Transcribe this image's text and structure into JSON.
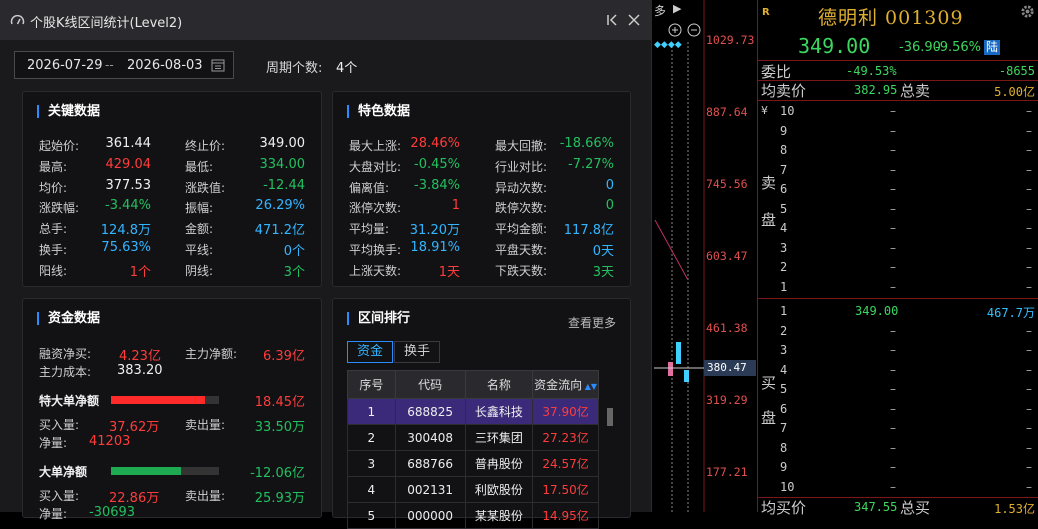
{
  "chart": {
    "price_axis": [
      "1029.73",
      "887.64",
      "745.56",
      "603.47",
      "461.38",
      "380.47",
      "319.29",
      "177.21"
    ],
    "top_text": "多"
  },
  "quote": {
    "r_badge": "R",
    "name": "德明利 001309",
    "price": "349.00",
    "change": "-36.90",
    "change_pct": "-9.56%",
    "tag": "陆",
    "weibi_label": "委比",
    "weibi_pct": "-49.53%",
    "weibi_diff": "-8655",
    "avg_sell_label": "均卖价",
    "avg_sell_price": "382.95",
    "total_sell_label": "总卖",
    "total_sell": "5.00亿",
    "sell_side": [
      "卖",
      "盘"
    ],
    "yen": "¥",
    "sell_levels": [
      "10",
      "9",
      "8",
      "7",
      "6",
      "5",
      "4",
      "3",
      "2",
      "1"
    ],
    "buy_side": [
      "买",
      "盘"
    ],
    "buy_levels": [
      "1",
      "2",
      "3",
      "4",
      "5",
      "6",
      "7",
      "8",
      "9",
      "10"
    ],
    "buy1_price": "349.00",
    "buy1_vol": "467.7万",
    "dash": "–",
    "avg_buy_label": "均买价",
    "avg_buy_price": "347.55",
    "total_buy_label": "总买",
    "total_buy": "1.53亿"
  },
  "dialog": {
    "title": "个股K线区间统计(Level2)",
    "start_date": "2026-07-29",
    "date_sep": "--",
    "end_date": "2026-08-03",
    "period_label": "周期个数:",
    "period_value": "4个",
    "key": {
      "title": "关键数据",
      "rows": [
        [
          "起始价:",
          "361.44",
          "终止价:",
          "349.00"
        ],
        [
          "最高:",
          "429.04",
          "最低:",
          "334.00"
        ],
        [
          "均价:",
          "377.53",
          "涨跌值:",
          "-12.44"
        ],
        [
          "涨跌幅:",
          "-3.44%",
          "振幅:",
          "26.29%"
        ],
        [
          "总手:",
          "124.8万",
          "金额:",
          "471.2亿"
        ],
        [
          "换手:",
          "75.63%",
          "平线:",
          "0个"
        ],
        [
          "阳线:",
          "1个",
          "阴线:",
          "3个"
        ]
      ]
    },
    "feature": {
      "title": "特色数据",
      "rows": [
        [
          "最大上涨:",
          "28.46%",
          "最大回撤:",
          "-18.66%"
        ],
        [
          "大盘对比:",
          "-0.45%",
          "行业对比:",
          "-7.27%"
        ],
        [
          "偏离值:",
          "-3.84%",
          "异动次数:",
          "0"
        ],
        [
          "涨停次数:",
          "1",
          "跌停次数:",
          "0"
        ],
        [
          "平均量:",
          "31.20万",
          "平均金额:",
          "117.8亿"
        ],
        [
          "平均换手:",
          "18.91%",
          "平盘天数:",
          "0天"
        ],
        [
          "上涨天数:",
          "1天",
          "下跌天数:",
          "3天"
        ]
      ]
    },
    "fund": {
      "title": "资金数据",
      "margin_label": "融资净买:",
      "margin_value": "4.23亿",
      "main_net_label": "主力净额:",
      "main_net_value": "6.39亿",
      "main_cost_label": "主力成本:",
      "main_cost_value": "383.20",
      "xl_label": "特大单净额",
      "xl_value": "18.45亿",
      "xl_fill": 0.87,
      "xl_buy_label": "买入量:",
      "xl_buy_value": "37.62万",
      "xl_sell_label": "卖出量:",
      "xl_sell_value": "33.50万",
      "xl_net_label": "净量:",
      "xl_net_value": "41203",
      "l_label": "大单净额",
      "l_value": "-12.06亿",
      "l_fill": 0.65,
      "l_buy_label": "买入量:",
      "l_buy_value": "22.86万",
      "l_sell_label": "卖出量:",
      "l_sell_value": "25.93万",
      "l_net_label": "净量:",
      "l_net_value": "-30693"
    },
    "rank": {
      "title": "区间排行",
      "more": "查看更多",
      "tabs": [
        "资金",
        "换手"
      ],
      "headers": [
        "序号",
        "代码",
        "名称",
        "资金流向"
      ],
      "rows": [
        [
          "1",
          "688825",
          "长鑫科技",
          "37.90亿"
        ],
        [
          "2",
          "300408",
          "三环集团",
          "27.23亿"
        ],
        [
          "3",
          "688766",
          "普冉股份",
          "24.57亿"
        ],
        [
          "4",
          "002131",
          "利欧股份",
          "17.50亿"
        ],
        [
          "5",
          "000000",
          "某某股份",
          "14.95亿"
        ]
      ]
    }
  },
  "colors": {
    "up": "#ff3c3c",
    "down": "#22c060",
    "accent": "#2a8cff",
    "cyan": "#33b5ff"
  }
}
